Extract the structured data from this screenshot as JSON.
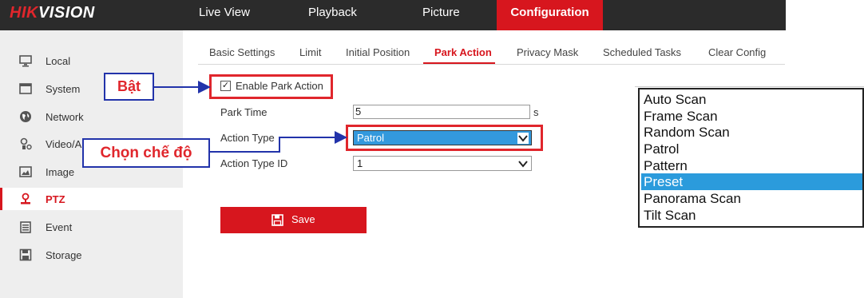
{
  "header": {
    "logo_brand": "HIK",
    "logo_rest": "VISION",
    "nav": [
      "Live View",
      "Playback",
      "Picture",
      "Configuration"
    ]
  },
  "sidebar": {
    "items": [
      {
        "label": "Local",
        "icon": "monitor-icon"
      },
      {
        "label": "System",
        "icon": "system-window-icon"
      },
      {
        "label": "Network",
        "icon": "globe-icon"
      },
      {
        "label": "Video/A",
        "icon": "camera-icon"
      },
      {
        "label": "Image",
        "icon": "image-icon"
      },
      {
        "label": "PTZ",
        "icon": "ptz-icon"
      },
      {
        "label": "Event",
        "icon": "event-list-icon"
      },
      {
        "label": "Storage",
        "icon": "floppy-icon"
      }
    ],
    "active": "PTZ"
  },
  "tabs": [
    "Basic Settings",
    "Limit",
    "Initial Position",
    "Park Action",
    "Privacy Mask",
    "Scheduled Tasks",
    "Clear Config"
  ],
  "form": {
    "enable_label": "Enable Park Action",
    "enable_checked": "✓",
    "park_time_label": "Park Time",
    "park_time_value": "5",
    "park_time_unit": "s",
    "action_type_label": "Action Type",
    "action_type_value": "Patrol",
    "action_type_id_label": "Action Type ID",
    "action_type_id_value": "1",
    "save_label": "Save"
  },
  "annotations": {
    "bat": "Bật",
    "chon_che_do": "Chọn chế độ"
  },
  "dropdown": {
    "options": [
      "Auto Scan",
      "Frame Scan",
      "Random Scan",
      "Patrol",
      "Pattern",
      "Preset",
      "Panorama Scan",
      "Tilt Scan"
    ],
    "selected": "Preset"
  },
  "colors": {
    "accent": "#d7161e",
    "topbar": "#2b2b2b",
    "annotation_border": "#2233aa",
    "highlight": "#2b9bdc"
  }
}
